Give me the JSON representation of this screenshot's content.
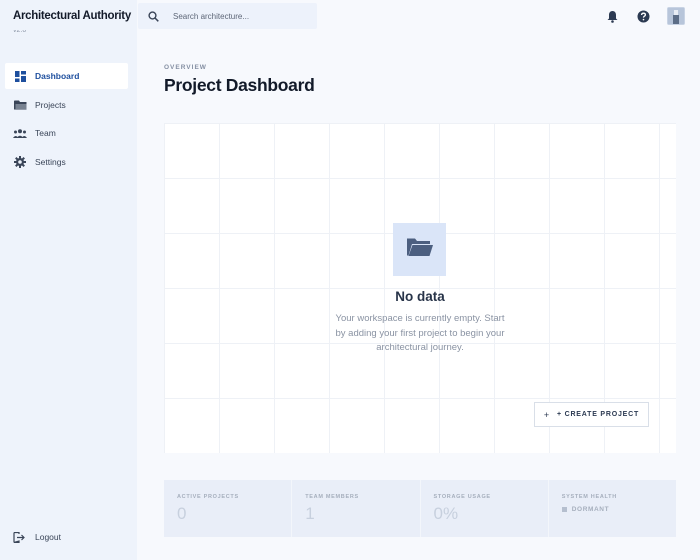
{
  "app": {
    "title": "Architectural Authority",
    "version": "v2.0"
  },
  "search": {
    "placeholder": "Search architecture..."
  },
  "sidebar": {
    "items": [
      {
        "label": "Dashboard",
        "icon": "dashboard-icon",
        "active": true
      },
      {
        "label": "Projects",
        "icon": "folder-icon",
        "active": false
      },
      {
        "label": "Team",
        "icon": "team-icon",
        "active": false
      },
      {
        "label": "Settings",
        "icon": "gear-icon",
        "active": false
      }
    ],
    "logout_label": "Logout"
  },
  "header": {
    "icons": [
      "bell-icon",
      "help-icon",
      "avatar"
    ]
  },
  "main": {
    "overline": "OVERVIEW",
    "title": "Project Dashboard",
    "empty": {
      "title": "No data",
      "description": "Your workspace is currently empty. Start by adding your first project to begin your architectural journey.",
      "button_label": "+ CREATE PROJECT"
    },
    "stats": [
      {
        "label": "ACTIVE PROJECTS",
        "value": "0"
      },
      {
        "label": "TEAM MEMBERS",
        "value": "1"
      },
      {
        "label": "STORAGE USAGE",
        "value": "0%"
      },
      {
        "label": "SYSTEM HEALTH",
        "status": "DORMANT"
      }
    ]
  },
  "colors": {
    "accent": "#1e4f9e",
    "sidebar_bg": "#eef3fb",
    "page_bg": "#f7f9fd",
    "empty_icon_bg": "#dae5f8"
  }
}
